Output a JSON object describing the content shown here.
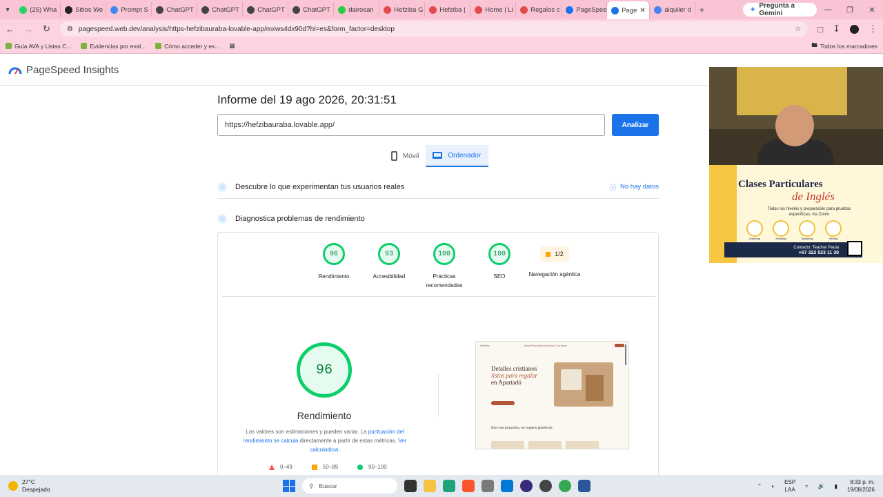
{
  "browser": {
    "menu_icon": "chevron-down-icon",
    "tabs": [
      {
        "label": "(25) Wha",
        "icon": "whatsapp-icon",
        "color": "#25d366"
      },
      {
        "label": "Sitios We",
        "icon": "site-icon",
        "color": "#222222"
      },
      {
        "label": "Prompt S",
        "icon": "doc-icon",
        "color": "#4285f4"
      },
      {
        "label": "ChatGPT",
        "icon": "chatgpt-icon",
        "color": "#444444"
      },
      {
        "label": "ChatGPT",
        "icon": "chatgpt-icon",
        "color": "#444444"
      },
      {
        "label": "ChatGPT",
        "icon": "chatgpt-icon",
        "color": "#444444"
      },
      {
        "label": "ChatGPT",
        "icon": "chatgpt-icon",
        "color": "#444444"
      },
      {
        "label": "dairosan",
        "icon": "k-icon",
        "color": "#2ecc40"
      },
      {
        "label": "Hefziba G",
        "icon": "lovable-icon",
        "color": "#e5484d"
      },
      {
        "label": "Hefziba |",
        "icon": "lovable-icon",
        "color": "#e5484d"
      },
      {
        "label": "Home | Li",
        "icon": "lovable-icon",
        "color": "#e5484d"
      },
      {
        "label": "Regalos c",
        "icon": "lovable-icon",
        "color": "#e5484d"
      },
      {
        "label": "PageSpee",
        "icon": "pagespeed-icon",
        "color": "#1a73e8"
      },
      {
        "label": "Page",
        "icon": "pagespeed-icon",
        "color": "#1a73e8",
        "active": true
      },
      {
        "label": "alquiler d",
        "icon": "google-icon",
        "color": "#4285f4"
      }
    ],
    "new_tab": "+",
    "gemini_label": "Pregunta a Gemini",
    "url": "pagespeed.web.dev/analysis/https-hefzibauraba-lovable-app/mxws4dx90d?hl=es&form_factor=desktop",
    "bookmarks": [
      {
        "label": "Guía AVA y Listas C..."
      },
      {
        "label": "Evidencias por eval..."
      },
      {
        "label": "Cómo acceder y ex..."
      }
    ],
    "all_bookmarks": "Todos los marcadores"
  },
  "psi": {
    "brand": "PageSpeed Insights",
    "report_title": "Informe del 19 ago 2026, 20:31:51",
    "url_value": "https://hefzibauraba.lovable.app/",
    "analyze_label": "Analizar",
    "device_tabs": {
      "mobile": "Móvil",
      "desktop": "Ordenador"
    },
    "real_users": {
      "title": "Descubre lo que experimentan tus usuarios reales",
      "status": "No hay datos"
    },
    "diagnose": {
      "title": "Diagnostica problemas de rendimiento"
    },
    "scores": [
      {
        "value": "96",
        "label": "Rendimiento"
      },
      {
        "value": "93",
        "label": "Accesibilidad"
      },
      {
        "value": "100",
        "label": "Prácticas recomendadas"
      },
      {
        "value": "100",
        "label": "SEO"
      }
    ],
    "agentic": {
      "value": "1/2",
      "label": "Navegación agéntica"
    },
    "big_score": "96",
    "big_label": "Rendimiento",
    "note": {
      "before": "Los valores son estimaciones y pueden variar. La ",
      "link1": "puntuación del rendimiento se calcula",
      "middle": " directamente a partir de estas métricas. ",
      "link2": "Ver calculadora."
    },
    "legend": [
      {
        "range": "0–49",
        "color": "#ff4e42"
      },
      {
        "range": "50–89",
        "color": "#ffa400"
      },
      {
        "range": "90–100",
        "color": "#0cce6b"
      }
    ],
    "screenshot": {
      "brand": "Hefziba",
      "nav": "Inicio  Productos  Nosotros  Contacto",
      "hero_1": "Detalles cristianos",
      "hero_2": "listos para regalar",
      "hero_3": "en Apartadó",
      "sub": "Kits con propósito, no regalos genéricos"
    }
  },
  "overlay_ad": {
    "title": "Clases Particulares",
    "subtitle": "de Inglés",
    "tagline": "Todos los niveles y preparación para pruebas específicas, vía Zoom",
    "skills": [
      "Listening",
      "Reading",
      "Speaking",
      "Writing"
    ],
    "contact": "Contacto: Teacher Paula",
    "phone": "+57 322 523 11 30"
  },
  "taskbar": {
    "temp": "27°C",
    "weather": "Despejado",
    "search_placeholder": "Buscar",
    "lang": "ESP",
    "lang2": "LAA",
    "time": "8:33 p. m.",
    "date": "19/08/2026"
  }
}
